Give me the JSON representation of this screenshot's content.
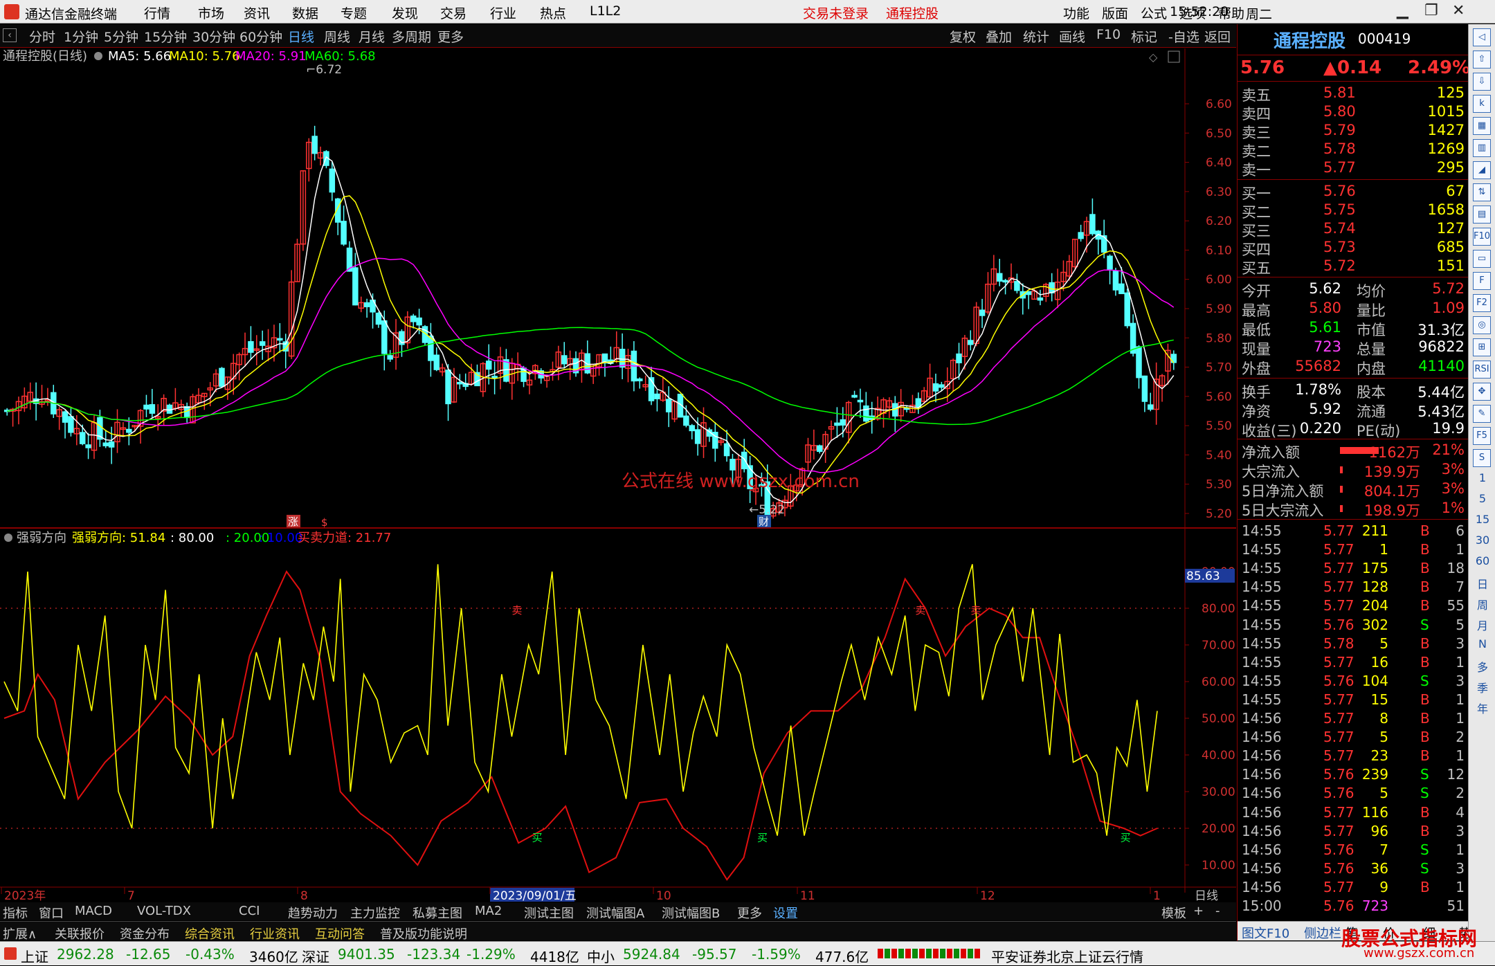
{
  "app": {
    "name": "通达信金融终端",
    "menus": [
      "行情",
      "市场",
      "资讯",
      "数据",
      "专题",
      "发现",
      "交易",
      "行业",
      "热点",
      "L1L2"
    ],
    "login_status": "交易未登录",
    "stock_name": "通程控股",
    "right_menus": [
      "功能",
      "版面",
      "公式",
      "选项",
      "帮助"
    ],
    "time": "15:52:20",
    "weekday": "周二"
  },
  "toolbar": {
    "periods": [
      "分时",
      "1分钟",
      "5分钟",
      "15分钟",
      "30分钟",
      "60分钟",
      "日线",
      "周线",
      "月线",
      "多周期",
      "更多"
    ],
    "active_period": "日线",
    "actions": [
      "复权",
      "叠加",
      "统计",
      "画线",
      "F10",
      "标记",
      "-自选",
      "返回"
    ]
  },
  "main_chart": {
    "title": "通程控股(日线)",
    "ma": [
      {
        "label": "MA5: 5.66",
        "color": "#ffffff"
      },
      {
        "label": "MA10: 5.76",
        "color": "#ffff00"
      },
      {
        "label": "MA20: 5.91",
        "color": "#ff00ff"
      },
      {
        "label": "MA60: 5.68",
        "color": "#00ff00"
      }
    ],
    "y_ticks": [
      "6.60",
      "6.50",
      "6.40",
      "6.30",
      "6.20",
      "6.10",
      "6.00",
      "5.90",
      "5.80",
      "5.70",
      "5.60",
      "5.50",
      "5.40",
      "5.30",
      "5.20"
    ],
    "high_label": "6.72",
    "low_label": "5.22",
    "marker_zhang": "涨",
    "marker_s": "$",
    "marker_cai": "财",
    "watermark": "公式在线 www.gszx.com.cn"
  },
  "indicator": {
    "name": "强弱方向",
    "label": "强弱方向: 51.84",
    "levels": [
      "80.00",
      "20.00",
      "10.00"
    ],
    "level_colors": [
      "#ffffff",
      "#00ff00",
      "#0000ff"
    ],
    "force_label": "买卖力道: 21.77",
    "y_ticks": [
      "90.00",
      "80.00",
      "70.00",
      "60.00",
      "50.00",
      "40.00",
      "30.00",
      "20.00",
      "10.00"
    ],
    "current_value": "85.63",
    "buy_label": "买",
    "sell_label": "卖"
  },
  "x_axis": {
    "labels": [
      "2023年",
      "7",
      "8",
      "2023/09/01/五",
      "10",
      "11",
      "12",
      "1"
    ],
    "cycle": "日线"
  },
  "bottom_tabs": [
    "指标",
    "窗口",
    "MACD",
    "VOL-TDX",
    "CCI",
    "趋势动力",
    "主力监控",
    "私募主图",
    "MA2",
    "测试主图",
    "测试幅图A",
    "测试幅图B",
    "更多",
    "设置"
  ],
  "bottom_tabs_right": [
    "模板",
    "+",
    "-"
  ],
  "bottom_tabs2": [
    {
      "label": "扩展∧",
      "color": "#c8c8c8"
    },
    {
      "label": "关联报价",
      "color": "#c8c8c8"
    },
    {
      "label": "资金分布",
      "color": "#c8c8c8"
    },
    {
      "label": "综合资讯",
      "color": "#e8d040"
    },
    {
      "label": "行业资讯",
      "color": "#e8d040"
    },
    {
      "label": "互动问答",
      "color": "#e8d040"
    },
    {
      "label": "普及版功能说明",
      "color": "#c8c8c8"
    }
  ],
  "quote": {
    "name": "通程控股",
    "code": "000419",
    "price": "5.76",
    "change": "▲0.14",
    "pct": "2.49%",
    "asks": [
      [
        "卖五",
        "5.81",
        "125"
      ],
      [
        "卖四",
        "5.80",
        "1015"
      ],
      [
        "卖三",
        "5.79",
        "1427"
      ],
      [
        "卖二",
        "5.78",
        "1269"
      ],
      [
        "卖一",
        "5.77",
        "295"
      ]
    ],
    "bids": [
      [
        "买一",
        "5.76",
        "67"
      ],
      [
        "买二",
        "5.75",
        "1658"
      ],
      [
        "买三",
        "5.74",
        "127"
      ],
      [
        "买四",
        "5.73",
        "685"
      ],
      [
        "买五",
        "5.72",
        "151"
      ]
    ],
    "stats": [
      [
        "今开",
        "5.62",
        "均价",
        "5.72"
      ],
      [
        "最高",
        "5.80",
        "量比",
        "1.09"
      ],
      [
        "最低",
        "5.61",
        "市值",
        "31.3亿"
      ],
      [
        "现量",
        "723",
        "总量",
        "96822"
      ],
      [
        "外盘",
        "55682",
        "内盘",
        "41140"
      ]
    ],
    "stats2": [
      [
        "换手",
        "1.78%",
        "股本",
        "5.44亿"
      ],
      [
        "净资",
        "5.92",
        "流通",
        "5.43亿"
      ],
      [
        "收益(三)",
        "0.220",
        "PE(动)",
        "19.9"
      ]
    ],
    "flows": [
      [
        "净流入额",
        "1162万",
        "21%"
      ],
      [
        "大宗流入",
        "139.9万",
        "3%"
      ],
      [
        "5日净流入额",
        "804.1万",
        "3%"
      ],
      [
        "5日大宗流入",
        "198.9万",
        "1%"
      ]
    ],
    "ticks": [
      [
        "14:55",
        "5.77",
        "211",
        "B",
        "6"
      ],
      [
        "14:55",
        "5.77",
        "1",
        "B",
        "1"
      ],
      [
        "14:55",
        "5.77",
        "175",
        "B",
        "18"
      ],
      [
        "14:55",
        "5.77",
        "128",
        "B",
        "7"
      ],
      [
        "14:55",
        "5.77",
        "204",
        "B",
        "55"
      ],
      [
        "14:55",
        "5.76",
        "302",
        "S",
        "5"
      ],
      [
        "14:55",
        "5.78",
        "5",
        "B",
        "3"
      ],
      [
        "14:55",
        "5.77",
        "16",
        "B",
        "1"
      ],
      [
        "14:55",
        "5.76",
        "104",
        "S",
        "3"
      ],
      [
        "14:55",
        "5.77",
        "15",
        "B",
        "1"
      ],
      [
        "14:56",
        "5.77",
        "8",
        "B",
        "1"
      ],
      [
        "14:56",
        "5.77",
        "5",
        "B",
        "2"
      ],
      [
        "14:56",
        "5.77",
        "23",
        "B",
        "1"
      ],
      [
        "14:56",
        "5.76",
        "239",
        "S",
        "12"
      ],
      [
        "14:56",
        "5.76",
        "5",
        "S",
        "2"
      ],
      [
        "14:56",
        "5.77",
        "116",
        "B",
        "4"
      ],
      [
        "14:56",
        "5.77",
        "96",
        "B",
        "3"
      ],
      [
        "14:56",
        "5.76",
        "7",
        "S",
        "1"
      ],
      [
        "14:56",
        "5.76",
        "36",
        "S",
        "3"
      ],
      [
        "14:56",
        "5.77",
        "9",
        "B",
        "1"
      ],
      [
        "15:00",
        "5.76",
        "723",
        "",
        "51"
      ]
    ],
    "bottom_links": [
      "图文F10",
      "侧边栏《",
      "笔",
      "价",
      "细",
      "势"
    ]
  },
  "sidebar_icons": [
    "up-arrow",
    "down-arrow",
    "k",
    "bars",
    "zoom",
    "line",
    "arrows",
    "grid",
    "F10",
    "list",
    "F",
    "F2",
    "circle",
    "RSI",
    "move",
    "pen",
    "F5",
    "S",
    "1",
    "5",
    "15",
    "30",
    "60",
    "日",
    "周",
    "月",
    "多",
    "季",
    "年"
  ],
  "status": {
    "sh": {
      "label": "上证",
      "value": "2962.28",
      "chg": "-12.65",
      "pct": "-0.43%",
      "vol": "3460亿"
    },
    "sz": {
      "label": "深证",
      "value": "9401.35",
      "chg": "-123.34",
      "pct": "-1.29%",
      "vol": "4418亿"
    },
    "zx": {
      "label": "中小",
      "value": "5924.84",
      "chg": "-95.57",
      "pct": "-1.59%",
      "vol": "477.6亿"
    },
    "server": "平安证券北京上证云行情",
    "brand": "股票公式指标网",
    "brand_url": "www.gszx.com.cn"
  }
}
